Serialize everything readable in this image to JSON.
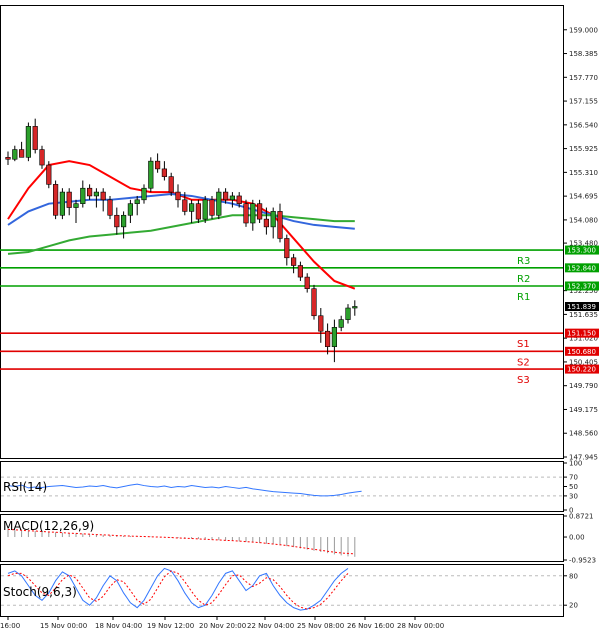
{
  "chart_data": [
    {
      "type": "candlestick",
      "title": "",
      "ylim": [
        147.945,
        159.615
      ],
      "y_ticks": [
        "159.000",
        "158.385",
        "157.770",
        "157.155",
        "156.540",
        "155.925",
        "155.310",
        "154.695",
        "154.080",
        "153.480",
        "152.250",
        "151.635",
        "151.020",
        "150.405",
        "149.790",
        "149.175",
        "148.560",
        "147.945"
      ],
      "x_ticks": [
        "16:00",
        "15 Nov 00:00",
        "18 Nov 04:00",
        "19 Nov 12:00",
        "20 Nov 20:00",
        "22 Nov 04:00",
        "25 Nov 08:00",
        "26 Nov 16:00",
        "28 Nov 00:00"
      ],
      "current_price": "151.839",
      "levels": [
        {
          "label": "R3",
          "value": "153.300",
          "color": "#00a000"
        },
        {
          "label": "R2",
          "value": "152.840",
          "color": "#00a000"
        },
        {
          "label": "R1",
          "value": "152.370",
          "color": "#00a000"
        },
        {
          "label": "S1",
          "value": "151.150",
          "color": "#e00000"
        },
        {
          "label": "S2",
          "value": "150.680",
          "color": "#e00000"
        },
        {
          "label": "S3",
          "value": "150.220",
          "color": "#e00000"
        }
      ],
      "candles": [
        [
          155.7,
          155.85,
          155.5,
          155.65
        ],
        [
          155.65,
          156.0,
          155.6,
          155.9
        ],
        [
          155.9,
          156.1,
          155.7,
          155.7
        ],
        [
          155.7,
          156.6,
          155.6,
          156.5
        ],
        [
          156.5,
          156.7,
          155.8,
          155.9
        ],
        [
          155.9,
          156.0,
          155.4,
          155.5
        ],
        [
          155.5,
          155.6,
          154.9,
          155.0
        ],
        [
          155.0,
          155.1,
          154.1,
          154.2
        ],
        [
          154.2,
          154.9,
          154.1,
          154.8
        ],
        [
          154.8,
          154.9,
          154.2,
          154.4
        ],
        [
          154.4,
          154.6,
          154.0,
          154.5
        ],
        [
          154.5,
          155.1,
          154.4,
          154.9
        ],
        [
          154.9,
          155.0,
          154.6,
          154.7
        ],
        [
          154.7,
          154.9,
          154.4,
          154.8
        ],
        [
          154.8,
          154.9,
          154.3,
          154.6
        ],
        [
          154.6,
          154.7,
          154.1,
          154.2
        ],
        [
          154.2,
          154.4,
          153.7,
          153.9
        ],
        [
          153.9,
          154.3,
          153.6,
          154.2
        ],
        [
          154.2,
          154.6,
          154.0,
          154.5
        ],
        [
          154.5,
          154.7,
          154.2,
          154.6
        ],
        [
          154.6,
          155.0,
          154.5,
          154.9
        ],
        [
          154.9,
          155.7,
          154.8,
          155.6
        ],
        [
          155.6,
          155.8,
          155.3,
          155.4
        ],
        [
          155.4,
          155.6,
          155.1,
          155.2
        ],
        [
          155.2,
          155.3,
          154.7,
          154.8
        ],
        [
          154.8,
          155.0,
          154.4,
          154.6
        ],
        [
          154.6,
          154.8,
          154.2,
          154.3
        ],
        [
          154.3,
          154.6,
          154.0,
          154.5
        ],
        [
          154.5,
          154.6,
          154.0,
          154.1
        ],
        [
          154.1,
          154.7,
          154.0,
          154.6
        ],
        [
          154.6,
          154.7,
          154.1,
          154.2
        ],
        [
          154.2,
          154.9,
          154.1,
          154.8
        ],
        [
          154.8,
          154.9,
          154.5,
          154.6
        ],
        [
          154.6,
          154.8,
          154.4,
          154.7
        ],
        [
          154.7,
          154.8,
          154.4,
          154.5
        ],
        [
          154.5,
          154.6,
          153.9,
          154.0
        ],
        [
          154.0,
          154.6,
          153.8,
          154.5
        ],
        [
          154.5,
          154.6,
          154.0,
          154.1
        ],
        [
          154.1,
          154.4,
          153.7,
          153.9
        ],
        [
          153.9,
          154.4,
          153.6,
          154.3
        ],
        [
          154.3,
          154.5,
          153.5,
          153.6
        ],
        [
          153.6,
          153.7,
          152.9,
          153.1
        ],
        [
          153.1,
          153.2,
          152.7,
          152.9
        ],
        [
          152.9,
          153.0,
          152.5,
          152.6
        ],
        [
          152.6,
          152.7,
          152.2,
          152.3
        ],
        [
          152.3,
          152.4,
          151.5,
          151.6
        ],
        [
          151.6,
          151.8,
          150.9,
          151.2
        ],
        [
          151.2,
          151.4,
          150.6,
          150.8
        ],
        [
          150.8,
          151.5,
          150.4,
          151.3
        ],
        [
          151.3,
          151.6,
          151.2,
          151.5
        ],
        [
          151.5,
          151.9,
          151.4,
          151.8
        ],
        [
          151.8,
          152.0,
          151.6,
          151.84
        ]
      ],
      "series": [
        {
          "name": "",
          "color": "#ff0000",
          "values": [
            [
              0,
              154.1
            ],
            [
              3,
              154.9
            ],
            [
              6,
              155.5
            ],
            [
              9,
              155.6
            ],
            [
              12,
              155.5
            ],
            [
              15,
              155.2
            ],
            [
              18,
              154.9
            ],
            [
              21,
              154.8
            ],
            [
              24,
              154.8
            ],
            [
              27,
              154.6
            ],
            [
              30,
              154.6
            ],
            [
              33,
              154.6
            ],
            [
              36,
              154.5
            ],
            [
              39,
              154.2
            ],
            [
              42,
              153.6
            ],
            [
              45,
              153.0
            ],
            [
              48,
              152.5
            ],
            [
              51,
              152.3
            ]
          ]
        },
        {
          "name": "",
          "color": "#3366dd",
          "values": [
            [
              0,
              153.95
            ],
            [
              3,
              154.3
            ],
            [
              6,
              154.5
            ],
            [
              9,
              154.55
            ],
            [
              12,
              154.6
            ],
            [
              15,
              154.6
            ],
            [
              18,
              154.65
            ],
            [
              21,
              154.7
            ],
            [
              24,
              154.75
            ],
            [
              27,
              154.7
            ],
            [
              30,
              154.6
            ],
            [
              33,
              154.5
            ],
            [
              36,
              154.35
            ],
            [
              39,
              154.2
            ],
            [
              42,
              154.05
            ],
            [
              45,
              153.95
            ],
            [
              48,
              153.9
            ],
            [
              51,
              153.85
            ]
          ]
        },
        {
          "name": "",
          "color": "#33aa33",
          "values": [
            [
              0,
              153.2
            ],
            [
              3,
              153.25
            ],
            [
              6,
              153.4
            ],
            [
              9,
              153.55
            ],
            [
              12,
              153.65
            ],
            [
              15,
              153.7
            ],
            [
              18,
              153.75
            ],
            [
              21,
              153.8
            ],
            [
              24,
              153.9
            ],
            [
              27,
              154.0
            ],
            [
              30,
              154.1
            ],
            [
              33,
              154.2
            ],
            [
              36,
              154.2
            ],
            [
              39,
              154.2
            ],
            [
              42,
              154.15
            ],
            [
              45,
              154.1
            ],
            [
              48,
              154.05
            ],
            [
              51,
              154.05
            ]
          ]
        }
      ],
      "grid": false
    },
    {
      "type": "line",
      "title": "RSI(14)",
      "ylim": [
        0,
        100
      ],
      "y_ticks": [
        "100",
        "70",
        "50",
        "30",
        "0"
      ],
      "series": [
        {
          "name": "",
          "color": "#3377ff",
          "values": [
            52,
            50,
            53,
            47,
            49,
            48,
            50,
            51,
            52,
            50,
            48,
            49,
            51,
            50,
            52,
            49,
            47,
            50,
            53,
            55,
            52,
            50,
            49,
            51,
            48,
            50,
            49,
            52,
            50,
            48,
            49,
            47,
            50,
            48,
            46,
            48,
            45,
            43,
            41,
            39,
            38,
            37,
            36,
            35,
            33,
            31,
            30,
            30,
            31,
            33,
            36,
            38,
            40
          ]
        }
      ]
    },
    {
      "type": "bar",
      "title": "MACD(12,26,9)",
      "ylim": [
        -0.9523,
        0.8721
      ],
      "y_ticks": [
        "0.8721",
        "0.00",
        "-0.9523"
      ],
      "values": [
        0.35,
        0.3,
        0.28,
        0.26,
        0.25,
        0.24,
        0.22,
        0.2,
        0.18,
        0.16,
        0.15,
        0.14,
        0.12,
        0.1,
        0.09,
        0.08,
        0.06,
        0.05,
        0.04,
        0.03,
        0.02,
        0.02,
        0.01,
        0.0,
        -0.02,
        -0.04,
        -0.05,
        -0.07,
        -0.08,
        -0.1,
        -0.12,
        -0.13,
        -0.15,
        -0.16,
        -0.18,
        -0.2,
        -0.22,
        -0.25,
        -0.28,
        -0.31,
        -0.34,
        -0.38,
        -0.42,
        -0.47,
        -0.52,
        -0.57,
        -0.62,
        -0.67,
        -0.72,
        -0.76,
        -0.8,
        -0.82
      ],
      "signal": [
        0.32,
        0.3,
        0.28,
        0.26,
        0.25,
        0.23,
        0.21,
        0.2,
        0.18,
        0.16,
        0.15,
        0.13,
        0.12,
        0.1,
        0.09,
        0.08,
        0.06,
        0.05,
        0.04,
        0.03,
        0.02,
        0.01,
        0.0,
        -0.01,
        -0.02,
        -0.04,
        -0.05,
        -0.06,
        -0.08,
        -0.09,
        -0.11,
        -0.12,
        -0.14,
        -0.15,
        -0.17,
        -0.19,
        -0.21,
        -0.23,
        -0.26,
        -0.29,
        -0.32,
        -0.35,
        -0.39,
        -0.43,
        -0.47,
        -0.51,
        -0.55,
        -0.59,
        -0.63,
        -0.66,
        -0.68,
        -0.7
      ]
    },
    {
      "type": "line",
      "title": "Stoch(9,6,3)",
      "ylim": [
        0,
        100
      ],
      "y_ticks": [
        "80",
        "20"
      ],
      "series": [
        {
          "name": "",
          "color": "#3377ff",
          "values": [
            85,
            90,
            80,
            60,
            40,
            30,
            45,
            70,
            88,
            80,
            55,
            30,
            20,
            35,
            60,
            80,
            70,
            45,
            25,
            15,
            30,
            55,
            80,
            95,
            90,
            70,
            45,
            25,
            15,
            20,
            40,
            65,
            85,
            90,
            70,
            50,
            60,
            80,
            85,
            60,
            40,
            25,
            15,
            10,
            12,
            20,
            30,
            50,
            70,
            85,
            95
          ]
        },
        {
          "name": "",
          "color": "#ff0000",
          "values": [
            80,
            85,
            85,
            75,
            60,
            45,
            40,
            55,
            72,
            82,
            75,
            55,
            35,
            28,
            38,
            58,
            72,
            68,
            50,
            30,
            22,
            32,
            55,
            78,
            90,
            85,
            68,
            48,
            30,
            20,
            25,
            42,
            62,
            80,
            82,
            68,
            58,
            65,
            76,
            72,
            58,
            40,
            25,
            16,
            12,
            15,
            22,
            35,
            52,
            70,
            85
          ]
        }
      ]
    }
  ]
}
